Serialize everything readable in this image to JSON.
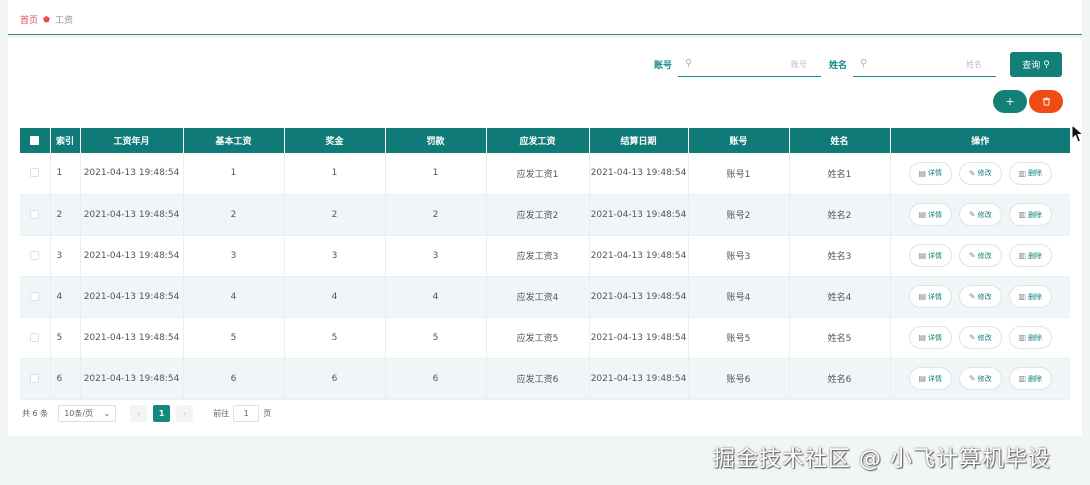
{
  "breadcrumb": {
    "home": "首页",
    "current": "工资"
  },
  "search": {
    "account_label": "账号",
    "account_placeholder": "账号",
    "name_label": "姓名",
    "name_placeholder": "姓名",
    "query_label": "查询"
  },
  "actions": {
    "add_label": "+"
  },
  "table": {
    "headers": [
      "索引",
      "工资年月",
      "基本工资",
      "奖金",
      "罚款",
      "应发工资",
      "结算日期",
      "账号",
      "姓名",
      "操作"
    ],
    "rows": [
      {
        "index": "1",
        "month": "2021-04-13 19:48:54",
        "base": "1",
        "bonus": "1",
        "fine": "1",
        "payable": "应发工资1",
        "settle": "2021-04-13 19:48:54",
        "account": "账号1",
        "name": "姓名1"
      },
      {
        "index": "2",
        "month": "2021-04-13 19:48:54",
        "base": "2",
        "bonus": "2",
        "fine": "2",
        "payable": "应发工资2",
        "settle": "2021-04-13 19:48:54",
        "account": "账号2",
        "name": "姓名2"
      },
      {
        "index": "3",
        "month": "2021-04-13 19:48:54",
        "base": "3",
        "bonus": "3",
        "fine": "3",
        "payable": "应发工资3",
        "settle": "2021-04-13 19:48:54",
        "account": "账号3",
        "name": "姓名3"
      },
      {
        "index": "4",
        "month": "2021-04-13 19:48:54",
        "base": "4",
        "bonus": "4",
        "fine": "4",
        "payable": "应发工资4",
        "settle": "2021-04-13 19:48:54",
        "account": "账号4",
        "name": "姓名4"
      },
      {
        "index": "5",
        "month": "2021-04-13 19:48:54",
        "base": "5",
        "bonus": "5",
        "fine": "5",
        "payable": "应发工资5",
        "settle": "2021-04-13 19:48:54",
        "account": "账号5",
        "name": "姓名5"
      },
      {
        "index": "6",
        "month": "2021-04-13 19:48:54",
        "base": "6",
        "bonus": "6",
        "fine": "6",
        "payable": "应发工资6",
        "settle": "2021-04-13 19:48:54",
        "account": "账号6",
        "name": "姓名6"
      }
    ],
    "ops": {
      "detail": "详情",
      "edit": "修改",
      "delete": "删除"
    }
  },
  "pagination": {
    "total": "共 6 条",
    "page_size": "10条/页",
    "current_page": "1",
    "goto_label": "前往",
    "goto_value": "1",
    "page_suffix": "页"
  },
  "watermark": "掘金技术社区 @ 小飞计算机毕设",
  "colors": {
    "primary": "#138077",
    "danger": "#f04a15",
    "breadcrumb_home": "#e84a4a"
  }
}
